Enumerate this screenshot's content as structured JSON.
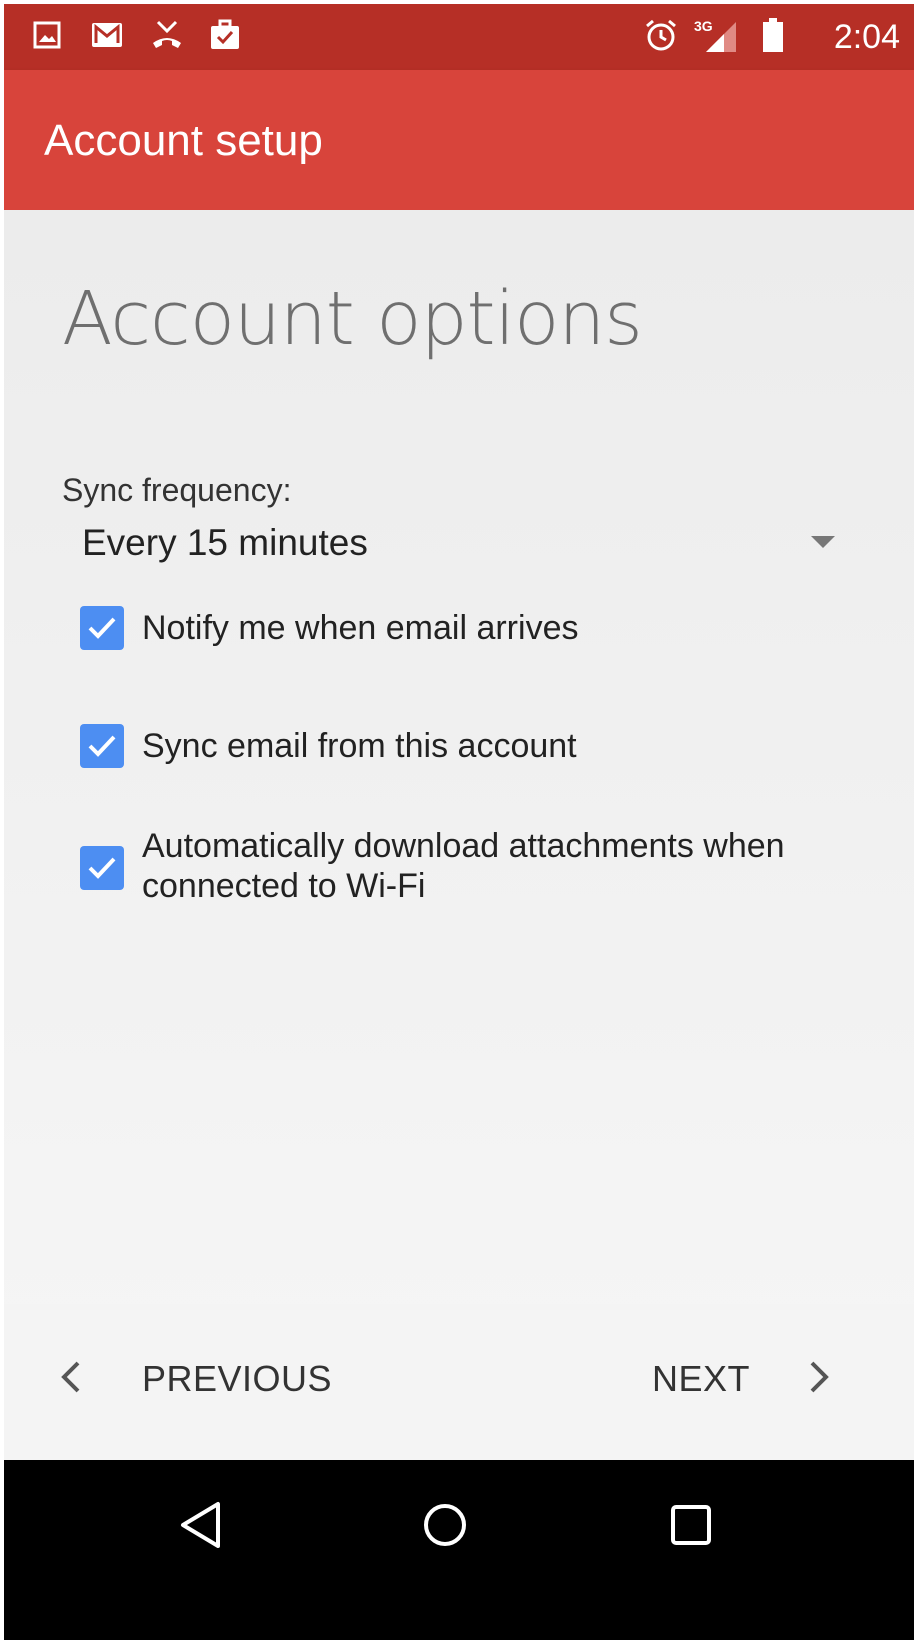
{
  "status_bar": {
    "time": "2:04",
    "network_label": "3G",
    "left_icons": [
      "image-icon",
      "gmail-icon",
      "missed-call-icon",
      "briefcase-check-icon"
    ],
    "right_icons": [
      "alarm-icon",
      "signal-icon",
      "battery-icon"
    ]
  },
  "app_bar": {
    "title": "Account setup"
  },
  "main": {
    "heading": "Account options",
    "sync_frequency": {
      "label": "Sync frequency:",
      "value": "Every 15 minutes"
    },
    "options": [
      {
        "label": "Notify me when email arrives",
        "checked": true
      },
      {
        "label": "Sync email from this account",
        "checked": true
      },
      {
        "label": "Automatically download attachments when connected to Wi-Fi",
        "checked": true
      }
    ]
  },
  "footer": {
    "previous_label": "PREVIOUS",
    "next_label": "NEXT"
  },
  "colors": {
    "status_bar": "#b62f26",
    "app_bar": "#d8443b",
    "checkbox": "#4d8ef2"
  }
}
